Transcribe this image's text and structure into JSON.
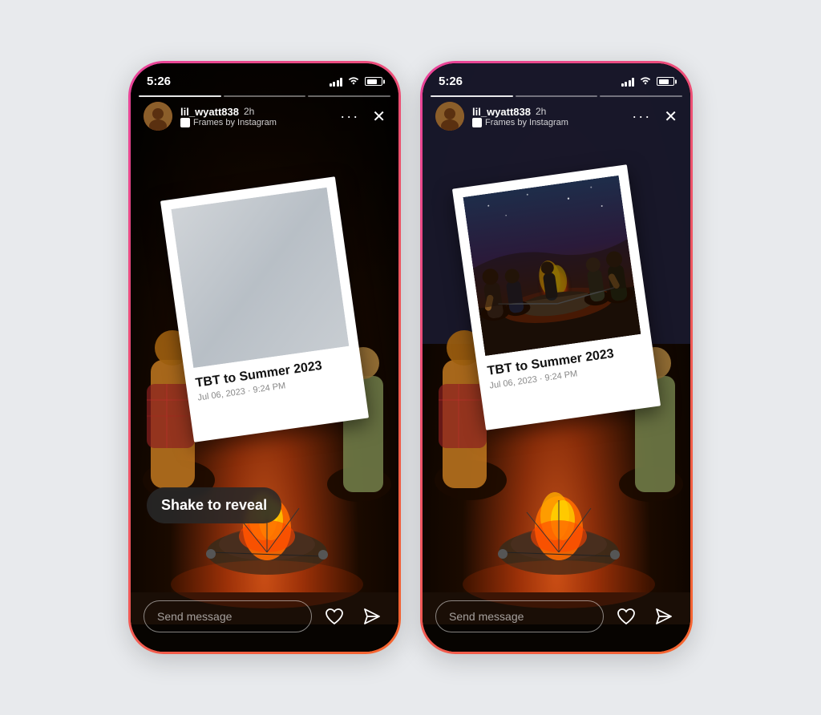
{
  "page": {
    "background_color": "#e8eaed"
  },
  "phone_left": {
    "status": {
      "time": "5:26",
      "signal": "signal",
      "wifi": "wifi",
      "battery": "battery"
    },
    "header": {
      "username": "lil_wyatt838",
      "time_ago": "2h",
      "frames_label": "Frames by Instagram",
      "more_label": "···",
      "close_label": "✕"
    },
    "polaroid": {
      "title": "TBT to Summer 2023",
      "date": "Jul 06, 2023 · 9:24 PM",
      "state": "hidden"
    },
    "shake_badge": "Shake to reveal",
    "message_placeholder": "Send message"
  },
  "phone_right": {
    "status": {
      "time": "5:26",
      "signal": "signal",
      "wifi": "wifi",
      "battery": "battery"
    },
    "header": {
      "username": "lil_wyatt838",
      "time_ago": "2h",
      "frames_label": "Frames by Instagram",
      "more_label": "···",
      "close_label": "✕"
    },
    "polaroid": {
      "title": "TBT to Summer 2023",
      "date": "Jul 06, 2023 · 9:24 PM",
      "state": "revealed"
    },
    "message_placeholder": "Send message"
  }
}
